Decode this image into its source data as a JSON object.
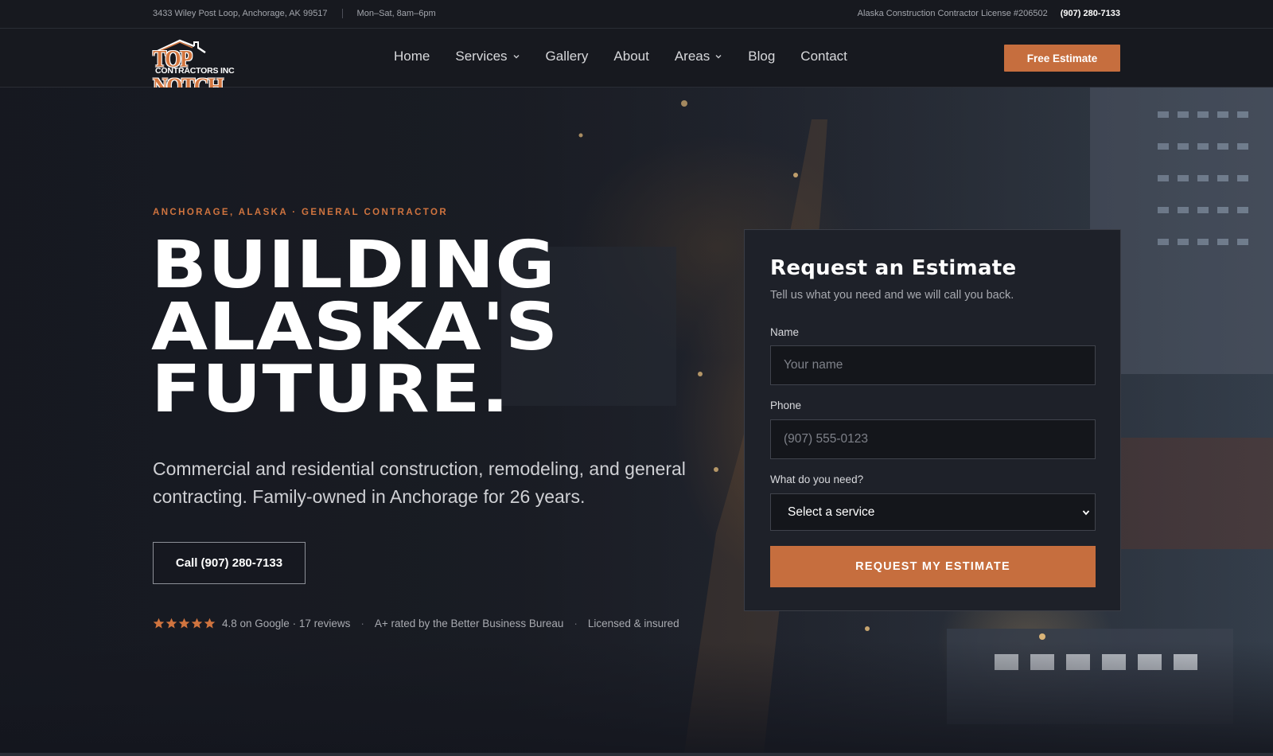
{
  "topbar": {
    "address": "3433 Wiley Post Loop, Anchorage, AK 99517",
    "hours": "Mon–Sat, 8am–6pm",
    "license": "Alaska Construction Contractor License #206502",
    "phone": "(907) 280-7133"
  },
  "logo": {
    "line1": "TOP NOTCH",
    "line2": "CONTRACTORS INC"
  },
  "nav": {
    "items": [
      {
        "label": "Home",
        "dropdown": false
      },
      {
        "label": "Services",
        "dropdown": true
      },
      {
        "label": "Gallery",
        "dropdown": false
      },
      {
        "label": "About",
        "dropdown": false
      },
      {
        "label": "Areas",
        "dropdown": true
      },
      {
        "label": "Blog",
        "dropdown": false
      },
      {
        "label": "Contact",
        "dropdown": false
      }
    ],
    "cta_label": "Free Estimate"
  },
  "hero": {
    "eyebrow": "ANCHORAGE, ALASKA · GENERAL CONTRACTOR",
    "headline": [
      "BUILDING",
      "ALASKA'S",
      "FUTURE."
    ],
    "lead": "Commercial and residential construction, remodeling, and general contracting. Family-owned in Anchorage for 26 years.",
    "call_label": "Call (907) 280-7133",
    "rating_stars": 5,
    "rating_text": "4.8 on Google · 17 reviews",
    "bbb_text": "A+ rated by the Better Business Bureau",
    "licensed_text": "Licensed & insured",
    "separator": "·"
  },
  "form": {
    "title": "Request an Estimate",
    "subtitle": "Tell us what you need and we will call you back.",
    "name_label": "Name",
    "name_placeholder": "Your name",
    "phone_label": "Phone",
    "phone_placeholder": "(907) 555-0123",
    "service_label": "What do you need?",
    "service_selected": "Select a service",
    "submit_label": "REQUEST MY ESTIMATE"
  },
  "colors": {
    "accent": "#c66e3e",
    "background": "#17191f",
    "card": "#1e2129"
  }
}
